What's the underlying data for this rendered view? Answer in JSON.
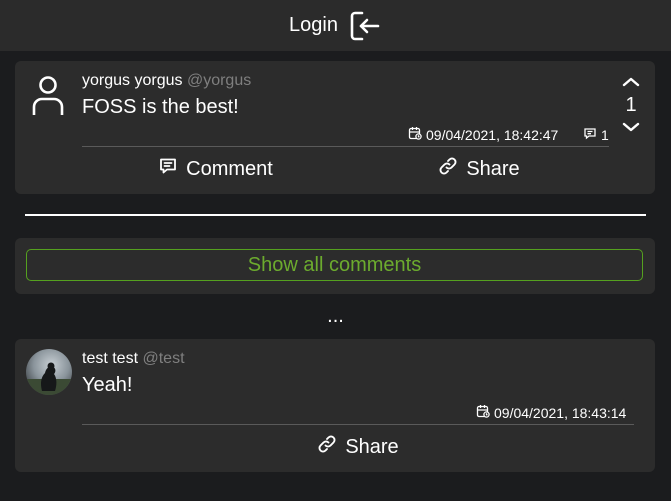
{
  "header": {
    "login_label": "Login",
    "login_icon": "login-icon"
  },
  "post": {
    "author_name": "yorgus yorgus",
    "author_handle": "@yorgus",
    "text": "FOSS is the best!",
    "votes": "1",
    "date": "09/04/2021, 18:42:47",
    "comment_count": "1",
    "comment_label": "Comment",
    "share_label": "Share"
  },
  "show_all_label": "Show all comments",
  "ellipsis": "...",
  "comment": {
    "author_name": "test test",
    "author_handle": "@test",
    "text": "Yeah!",
    "date": "09/04/2021, 18:43:14",
    "share_label": "Share"
  },
  "colors": {
    "accent_green": "#6cab2e",
    "card": "#2c2c2c",
    "background": "#1b1c1e"
  }
}
